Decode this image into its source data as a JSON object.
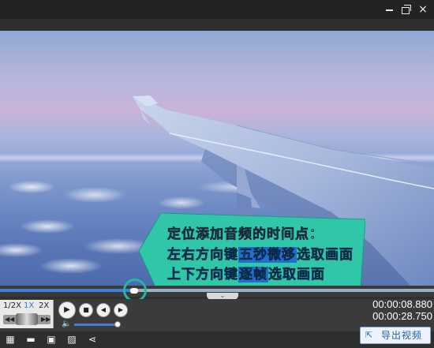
{
  "window": {
    "minimize_icon": "minimize-icon",
    "maximize_icon": "restore-icon",
    "close_glyph": "×"
  },
  "caption": {
    "line1": "定位添加音频的时间点：",
    "line2_a": "左右方向键",
    "line2_highlight": "五秒微移",
    "line2_b": "选取画面",
    "line3_a": "上下方向键",
    "line3_highlight": "逐帧",
    "line3_b": "选取画面",
    "bg_color": "#2fc7a8"
  },
  "timeline": {
    "progress": 0.31,
    "expand_glyph": "⌄"
  },
  "speed": {
    "options": [
      "1/2X",
      "1X",
      "2X"
    ],
    "selected": "1X"
  },
  "playback": {
    "play_glyph": "▶",
    "stop_glyph": "■",
    "prev_glyph": "◀",
    "next_glyph": "▶",
    "jog_left": "◀◀",
    "jog_right": "▶▶"
  },
  "volume": {
    "icon_glyph": "🔈",
    "level": 0.92
  },
  "time": {
    "current": "00:00:08.880",
    "total": "00:00:28.750"
  },
  "bottom_tools": {
    "new_glyph": "▦",
    "open_glyph": "▬",
    "save_glyph": "▣",
    "save_as_glyph": "▨",
    "share_glyph": "⋖"
  },
  "export": {
    "label": "导出视频",
    "icon_glyph": "⇱"
  },
  "colors": {
    "accent": "#3f7fd8",
    "caption_text": "#4bd0ff",
    "ring": "#27b4a4"
  }
}
